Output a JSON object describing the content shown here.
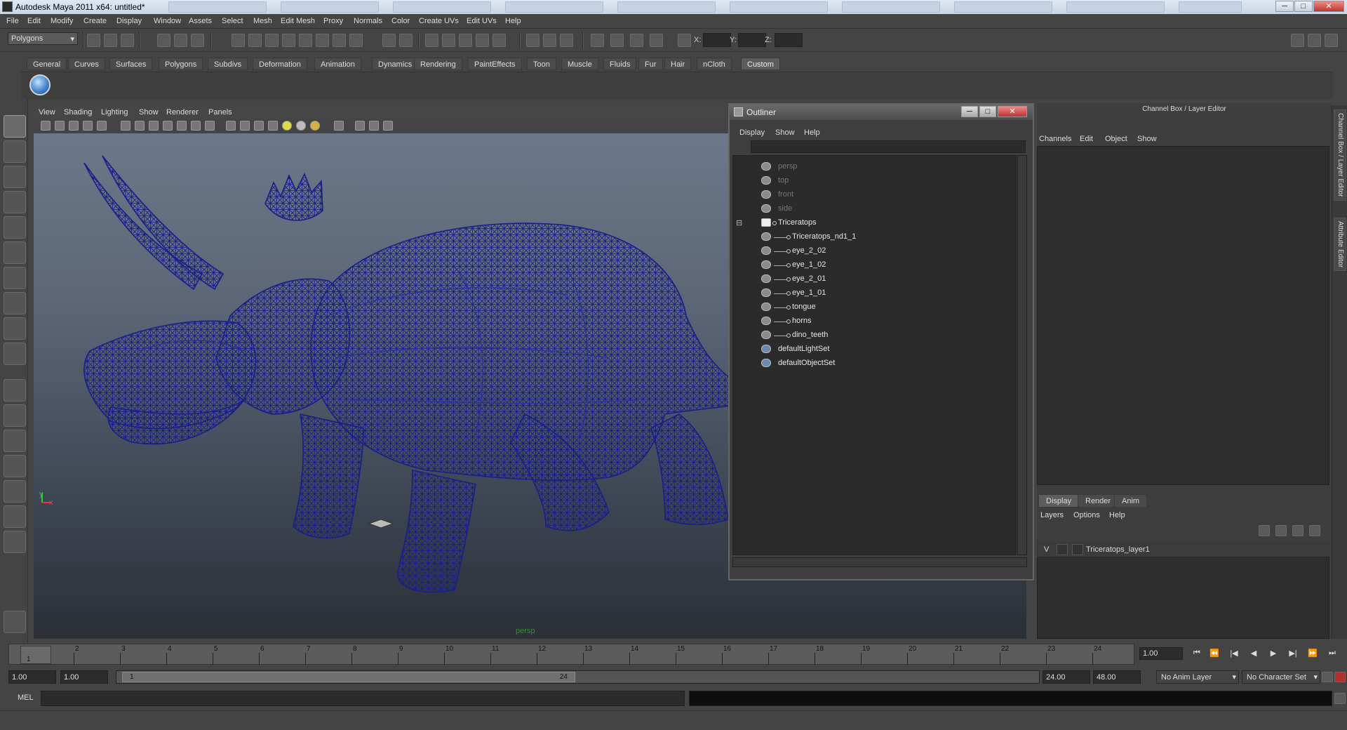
{
  "window": {
    "title": "Autodesk Maya 2011 x64: untitled*",
    "minimize": "─",
    "maximize": "□",
    "close": "✕"
  },
  "menubar": [
    "File",
    "Edit",
    "Modify",
    "Create",
    "Display",
    "Window",
    "Assets",
    "Select",
    "Mesh",
    "Edit Mesh",
    "Proxy",
    "Normals",
    "Color",
    "Create UVs",
    "Edit UVs",
    "Help"
  ],
  "status": {
    "mode": "Polygons",
    "coord_labels": [
      "X:",
      "Y:",
      "Z:"
    ]
  },
  "shelf_tabs": [
    "General",
    "Curves",
    "Surfaces",
    "Polygons",
    "Subdivs",
    "Deformation",
    "Animation",
    "Dynamics",
    "Rendering",
    "PaintEffects",
    "Toon",
    "Muscle",
    "Fluids",
    "Fur",
    "Hair",
    "nCloth",
    "Custom"
  ],
  "shelf_active": "Custom",
  "viewport": {
    "menu": [
      "View",
      "Shading",
      "Lighting",
      "Show",
      "Renderer",
      "Panels"
    ],
    "camera_label": "persp",
    "axis_x": "x",
    "axis_y": "y",
    "wire_color": "#1a1f8a"
  },
  "outliner": {
    "title": "Outliner",
    "menu": [
      "Display",
      "Show",
      "Help"
    ],
    "items": [
      {
        "label": "persp",
        "depth": 0,
        "dim": true
      },
      {
        "label": "top",
        "depth": 0,
        "dim": true
      },
      {
        "label": "front",
        "depth": 0,
        "dim": true
      },
      {
        "label": "side",
        "depth": 0,
        "dim": true
      },
      {
        "label": "Triceratops",
        "depth": 0,
        "dim": false,
        "expander": "⊟"
      },
      {
        "label": "Triceratops_nd1_1",
        "depth": 1,
        "dim": false
      },
      {
        "label": "eye_2_02",
        "depth": 1,
        "dim": false
      },
      {
        "label": "eye_1_02",
        "depth": 1,
        "dim": false
      },
      {
        "label": "eye_2_01",
        "depth": 1,
        "dim": false
      },
      {
        "label": "eye_1_01",
        "depth": 1,
        "dim": false
      },
      {
        "label": "tongue",
        "depth": 1,
        "dim": false
      },
      {
        "label": "horns",
        "depth": 1,
        "dim": false
      },
      {
        "label": "dino_teeth",
        "depth": 1,
        "dim": false
      },
      {
        "label": "defaultLightSet",
        "depth": 0,
        "dim": false
      },
      {
        "label": "defaultObjectSet",
        "depth": 0,
        "dim": false
      }
    ]
  },
  "channel_box": {
    "title": "Channel Box / Layer Editor",
    "menu": [
      "Channels",
      "Edit",
      "Object",
      "Show"
    ]
  },
  "side_tabs": [
    "Channel Box / Layer Editor",
    "Attribute Editor"
  ],
  "layer_editor": {
    "tabs": [
      "Display",
      "Render",
      "Anim"
    ],
    "active_tab": "Display",
    "menu": [
      "Layers",
      "Options",
      "Help"
    ],
    "layers": [
      {
        "visible": "V",
        "name": "Triceratops_layer1"
      }
    ]
  },
  "timeline": {
    "frames": [
      "1",
      "2",
      "3",
      "4",
      "5",
      "6",
      "7",
      "8",
      "9",
      "10",
      "11",
      "12",
      "13",
      "14",
      "15",
      "16",
      "17",
      "18",
      "19",
      "20",
      "21",
      "22",
      "23",
      "24"
    ],
    "current_marker": "1",
    "current_time": "1.00"
  },
  "range": {
    "start_time": "1.00",
    "playback_start": "1.00",
    "range_start_label": "1",
    "range_end_label": "24",
    "playback_end": "24.00",
    "end_time": "48.00",
    "anim_layer": "No Anim Layer",
    "char_set": "No Character Set"
  },
  "playback_buttons": [
    "⏮",
    "⏪",
    "|◀",
    "◀",
    "▶",
    "▶|",
    "⏩",
    "⏭"
  ],
  "cmd": {
    "label": "MEL"
  }
}
